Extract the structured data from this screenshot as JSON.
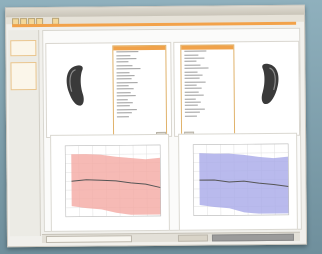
{
  "icons": {
    "hearing_aid": "hearing-aid-icon"
  },
  "colors": {
    "accent_orange": "#f2a24a",
    "left_band": "#f4a9a2",
    "right_band": "#a7a9e8",
    "curve": "#555555",
    "grid": "#e1e1e1"
  },
  "chart_data": [
    {
      "type": "line",
      "series": [
        {
          "values": [
            0.5,
            0.48,
            0.49,
            0.5,
            0.53,
            0.55,
            0.6
          ]
        },
        {
          "values": [
            0.12,
            0.12,
            0.13,
            0.16,
            0.18,
            0.2,
            0.18
          ]
        },
        {
          "values": [
            0.85,
            0.88,
            0.9,
            0.95,
            0.99,
            1.03,
            1.06
          ]
        }
      ]
    },
    {
      "type": "line",
      "series": [
        {
          "values": [
            0.5,
            0.5,
            0.53,
            0.52,
            0.55,
            0.57,
            0.6
          ]
        },
        {
          "values": [
            0.12,
            0.13,
            0.13,
            0.15,
            0.18,
            0.2,
            0.18
          ]
        },
        {
          "values": [
            0.85,
            0.88,
            0.9,
            0.96,
            1.0,
            1.04,
            1.06
          ]
        }
      ]
    }
  ]
}
